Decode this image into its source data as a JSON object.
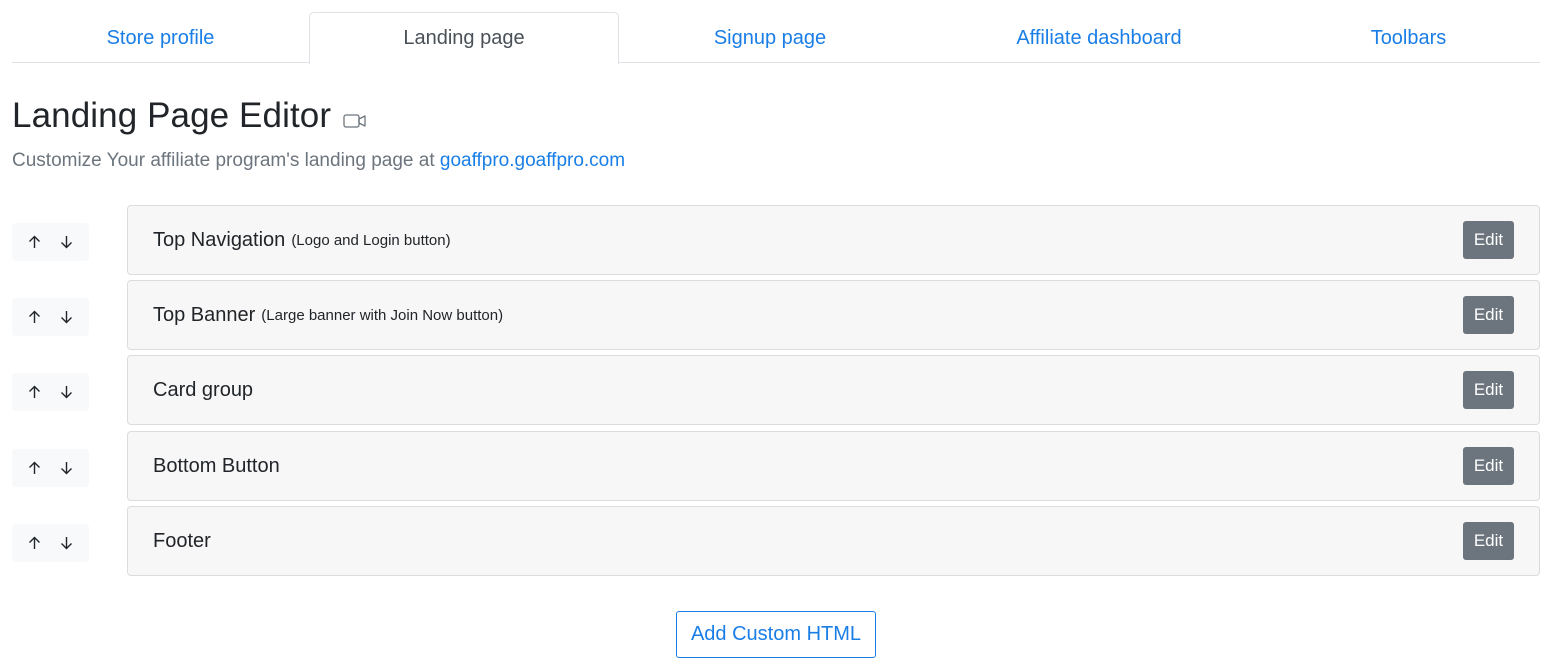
{
  "tabs": [
    {
      "label": "Store profile",
      "active": false
    },
    {
      "label": "Landing page",
      "active": true
    },
    {
      "label": "Signup page",
      "active": false
    },
    {
      "label": "Affiliate dashboard",
      "active": false
    },
    {
      "label": "Toolbars",
      "active": false
    }
  ],
  "header": {
    "title": "Landing Page Editor",
    "title_icon": "video-camera-icon",
    "subtitle_prefix": "Customize Your affiliate program's landing page at ",
    "subtitle_link": "goaffpro.goaffpro.com"
  },
  "sections": [
    {
      "title": "Top Navigation",
      "desc": "(Logo and Login button)",
      "edit_label": "Edit"
    },
    {
      "title": "Top Banner",
      "desc": "(Large banner with Join Now button)",
      "edit_label": "Edit"
    },
    {
      "title": "Card group",
      "desc": "",
      "edit_label": "Edit"
    },
    {
      "title": "Bottom Button",
      "desc": "",
      "edit_label": "Edit"
    },
    {
      "title": "Footer",
      "desc": "",
      "edit_label": "Edit"
    }
  ],
  "icons": {
    "move_up": "arrow-up-icon",
    "move_down": "arrow-down-icon"
  },
  "add_button_label": "Add Custom HTML",
  "colors": {
    "link": "#1a7ee6",
    "edit_button": "#6c757d",
    "card_bg": "#f7f7f7"
  }
}
